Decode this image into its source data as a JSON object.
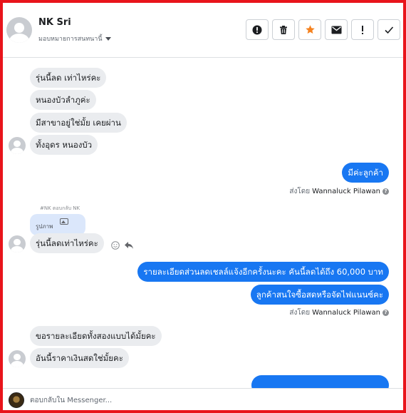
{
  "header": {
    "name": "NK Sri",
    "assign_label": "มอบหมายการสนทนานี้",
    "actions": [
      {
        "icon": "alert-circle-icon",
        "name": "mark-spam-button"
      },
      {
        "icon": "trash-icon",
        "name": "delete-button"
      },
      {
        "icon": "star-icon",
        "name": "star-button"
      },
      {
        "icon": "mail-icon",
        "name": "mark-unread-button"
      },
      {
        "icon": "exclamation-icon",
        "name": "follow-up-button"
      },
      {
        "icon": "check-icon",
        "name": "mark-done-button"
      }
    ],
    "star_color": "#f5821f"
  },
  "messages": {
    "m1": "รุ่นนี้ลด เท่าไหร่คะ",
    "m2": "หนองบัวลำภูค่ะ",
    "m3": "มีสาขาอยู่ใช่มั้ย เคยผ่าน",
    "m4": "ทั้งอุดร หนองบัว",
    "m5": "มีค่ะลูกค้า",
    "sent_by_prefix_1": "ส่งโดย",
    "sent_by_name_1": "Wannaluck Pilawan",
    "reply_label": "#NK ตอบกลับ NK",
    "quote_text": "รูปภาพ",
    "m6": "รุ่นนี้ลดเท่าไหร่คะ",
    "m7": "รายละเอียดส่วนลดเชลล์แจ้งอีกครั้งนะคะ  คันนี้ลดได้ถึง 60,000 บาท",
    "m8": "ลูกค้าสนใจซื้อสดหรือจัดไฟแนนซ์คะ",
    "sent_by_prefix_2": "ส่งโดย",
    "sent_by_name_2": "Wannaluck Pilawan",
    "m9": "ขอรายละเอียดทั้งสองแบบได้มั้ยคะ",
    "m10": "อันนี้ราคาเงินสดใช่มั้ยคะ"
  },
  "composer": {
    "placeholder": "ตอบกลับใน Messenger..."
  },
  "colors": {
    "outgoing": "#1877f2",
    "incoming": "#eaecef",
    "frame": "#e8141b"
  }
}
